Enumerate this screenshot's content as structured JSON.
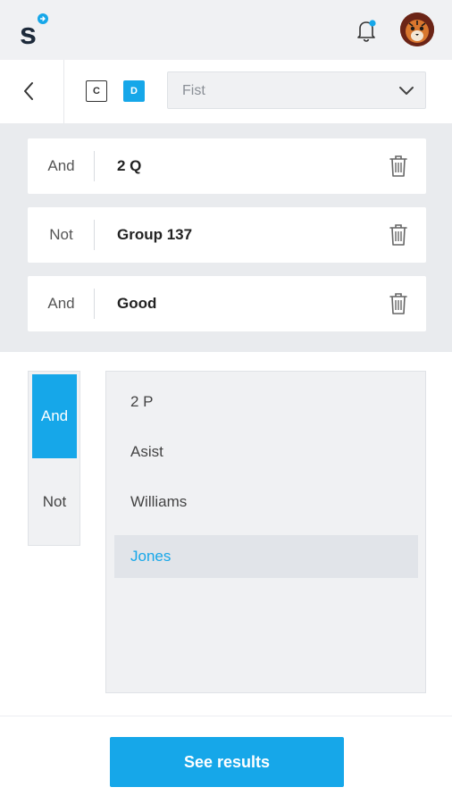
{
  "header": {
    "logo_icon": "s-logo-icon",
    "notification_icon": "bell-icon",
    "avatar_icon": "tiger-avatar"
  },
  "filter_bar": {
    "back_icon": "chevron-left-icon",
    "chips": [
      {
        "label": "C",
        "active": false
      },
      {
        "label": "D",
        "active": true
      }
    ],
    "select": {
      "value": "Fist",
      "icon": "chevron-down-icon"
    }
  },
  "conditions": [
    {
      "operator": "And",
      "value": "2 Q"
    },
    {
      "operator": "Not",
      "value": "Group 137"
    },
    {
      "operator": "And",
      "value": "Good"
    }
  ],
  "operator_picker": {
    "options": [
      "And",
      "Not"
    ],
    "selected": "And"
  },
  "options_list": {
    "items": [
      "2 P",
      "Asist",
      "Williams",
      "Jones"
    ],
    "selected": "Jones"
  },
  "footer": {
    "cta_label": "See results"
  },
  "colors": {
    "accent": "#16a7e9",
    "background": "#e9ebee",
    "panel": "#f0f1f3"
  }
}
